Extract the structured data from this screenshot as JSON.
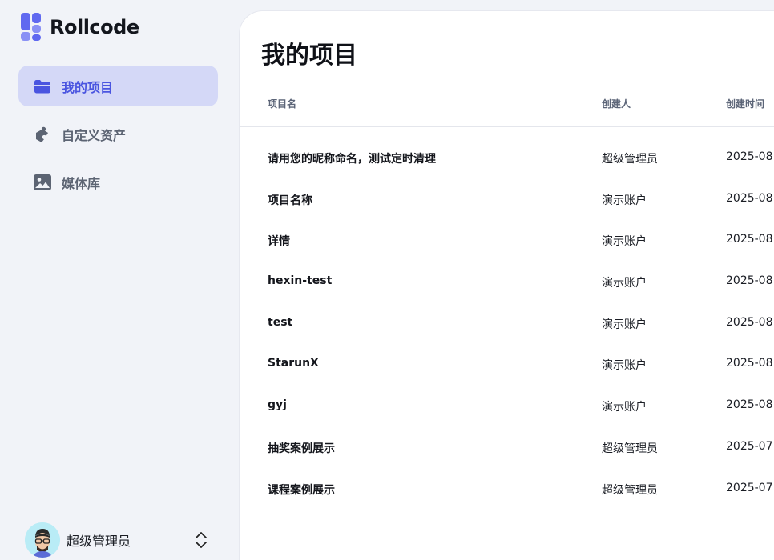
{
  "brand": {
    "name": "Rollcode",
    "accent": "#4a55e0",
    "logo_color": "#6069f0"
  },
  "sidebar": {
    "items": [
      {
        "label": "我的项目",
        "icon": "folder-icon",
        "active": true
      },
      {
        "label": "自定义资产",
        "icon": "puzzle-icon",
        "active": false
      },
      {
        "label": "媒体库",
        "icon": "image-icon",
        "active": false
      }
    ],
    "user": {
      "name": "超级管理员",
      "avatar": "avatar",
      "switch_icon": "chevron-up-down-icon"
    }
  },
  "main": {
    "title": "我的项目",
    "table": {
      "columns": [
        "项目名",
        "创建人",
        "创建时间"
      ],
      "rows": [
        {
          "name": "请用您的昵称命名，测试定时清理",
          "creator": "超级管理员",
          "created": "2025-08"
        },
        {
          "name": "项目名称",
          "creator": "演示账户",
          "created": "2025-08"
        },
        {
          "name": "详情",
          "creator": "演示账户",
          "created": "2025-08"
        },
        {
          "name": "hexin-test",
          "creator": "演示账户",
          "created": "2025-08"
        },
        {
          "name": "test",
          "creator": "演示账户",
          "created": "2025-08"
        },
        {
          "name": "StarunX",
          "creator": "演示账户",
          "created": "2025-08"
        },
        {
          "name": "gyj",
          "creator": "演示账户",
          "created": "2025-08"
        },
        {
          "name": "抽奖案例展示",
          "creator": "超级管理员",
          "created": "2025-07"
        },
        {
          "name": "课程案例展示",
          "creator": "超级管理员",
          "created": "2025-07"
        }
      ]
    }
  }
}
